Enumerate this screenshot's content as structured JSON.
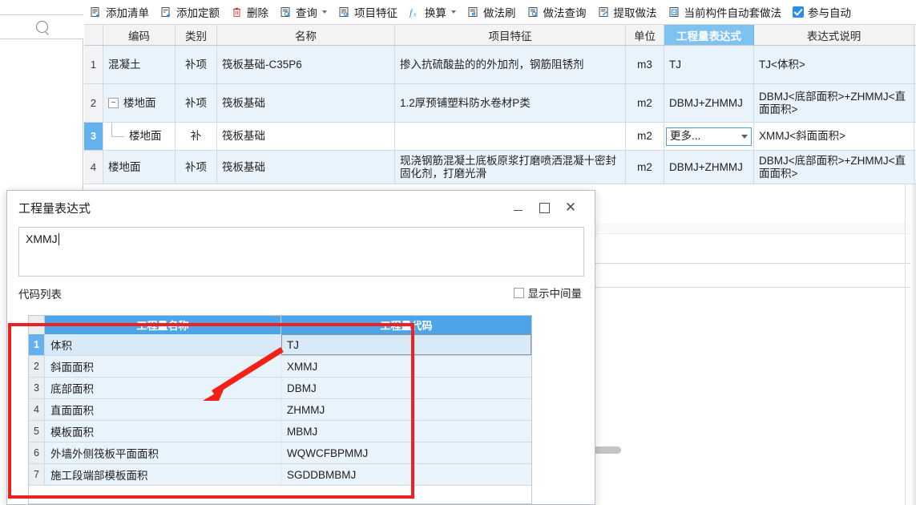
{
  "toolbar": {
    "items": [
      {
        "label": "添加清单",
        "icon": "add-list-icon",
        "caret": false
      },
      {
        "label": "添加定额",
        "icon": "add-quota-icon",
        "caret": false
      },
      {
        "label": "删除",
        "icon": "trash-icon",
        "caret": false
      },
      {
        "label": "查询",
        "icon": "query-icon",
        "caret": true
      },
      {
        "label": "项目特征",
        "icon": "feature-icon",
        "caret": false
      },
      {
        "label": "换算",
        "icon": "fx-icon",
        "caret": true
      },
      {
        "label": "做法刷",
        "icon": "method-brush-icon",
        "caret": false
      },
      {
        "label": "做法查询",
        "icon": "method-query-icon",
        "caret": false
      },
      {
        "label": "提取做法",
        "icon": "extract-method-icon",
        "caret": false
      },
      {
        "label": "当前构件自动套做法",
        "icon": "auto-apply-icon",
        "caret": false
      }
    ],
    "checkbox": {
      "label": "参与自动",
      "checked": true,
      "name": "participate-auto-checkbox"
    }
  },
  "left_panel": {
    "search_icon": "search-icon"
  },
  "grid": {
    "columns": [
      "编码",
      "类别",
      "名称",
      "项目特征",
      "单位",
      "工程量表达式",
      "表达式说明"
    ],
    "selected_column": "工程量表达式",
    "rows": [
      {
        "num": "1",
        "code": "混凝土",
        "type": "补项",
        "name": "筏板基础-C35P6",
        "feature": "掺入抗硫酸盐的的外加剂，钢筋阻锈剂",
        "unit": "m3",
        "expr": "TJ",
        "desc": "TJ<体积>",
        "selected": false,
        "tree": "none",
        "editing": false
      },
      {
        "num": "2",
        "code": "楼地面",
        "type": "补项",
        "name": "筏板基础",
        "feature": "1.2厚预铺塑料防水卷材P类",
        "unit": "m2",
        "expr": "DBMJ+ZHMMJ",
        "desc": "DBMJ<底部面积>+ZHMMJ<直面面积>",
        "selected": false,
        "tree": "parent",
        "editing": false
      },
      {
        "num": "3",
        "code": "楼地面",
        "type": "补",
        "name": "筏板基础",
        "feature": "",
        "unit": "m2",
        "expr": "更多...",
        "desc": "XMMJ<斜面面积>",
        "selected": true,
        "tree": "child",
        "editing": true
      },
      {
        "num": "4",
        "code": "楼地面",
        "type": "补项",
        "name": "筏板基础",
        "feature": "现浇钢筋混凝土底板原浆打磨喷洒混凝十密封固化剂，打磨光滑",
        "unit": "m2",
        "expr": "DBMJ+ZHMMJ",
        "desc": "DBMJ<底部面积>+ZHMMJ<直面面积>",
        "selected": false,
        "tree": "none",
        "editing": false
      }
    ]
  },
  "dialog": {
    "title": "工程量表达式",
    "window_buttons": {
      "minimize": "minimize-icon",
      "maximize": "maximize-icon",
      "close": "close-icon"
    },
    "expression_value": "XMMJ",
    "code_list_label": "代码列表",
    "show_intermediate": {
      "label": "显示中间量",
      "checked": false
    },
    "table": {
      "columns": [
        "工程量名称",
        "工程量代码"
      ],
      "rows": [
        {
          "num": "1",
          "name": "体积",
          "code": "TJ",
          "selected": true
        },
        {
          "num": "2",
          "name": "斜面面积",
          "code": "XMMJ",
          "selected": false
        },
        {
          "num": "3",
          "name": "底部面积",
          "code": "DBMJ",
          "selected": false
        },
        {
          "num": "4",
          "name": "直面面积",
          "code": "ZHMMJ",
          "selected": false
        },
        {
          "num": "5",
          "name": "模板面积",
          "code": "MBMJ",
          "selected": false
        },
        {
          "num": "6",
          "name": "外墙外侧筏板平面面积",
          "code": "WQWCFBPMMJ",
          "selected": false
        },
        {
          "num": "7",
          "name": "施工段端部模板面积",
          "code": "SGDDBMBMJ",
          "selected": false
        }
      ]
    }
  },
  "annotations": {
    "highlight_rect": "red-highlight-rectangle",
    "arrow": "red-arrow"
  },
  "colors": {
    "accent_blue": "#4ea4e8",
    "header_selected": "#7ec2f2",
    "row_blue": "#e9f3fb",
    "annotation_red": "#f02020"
  }
}
